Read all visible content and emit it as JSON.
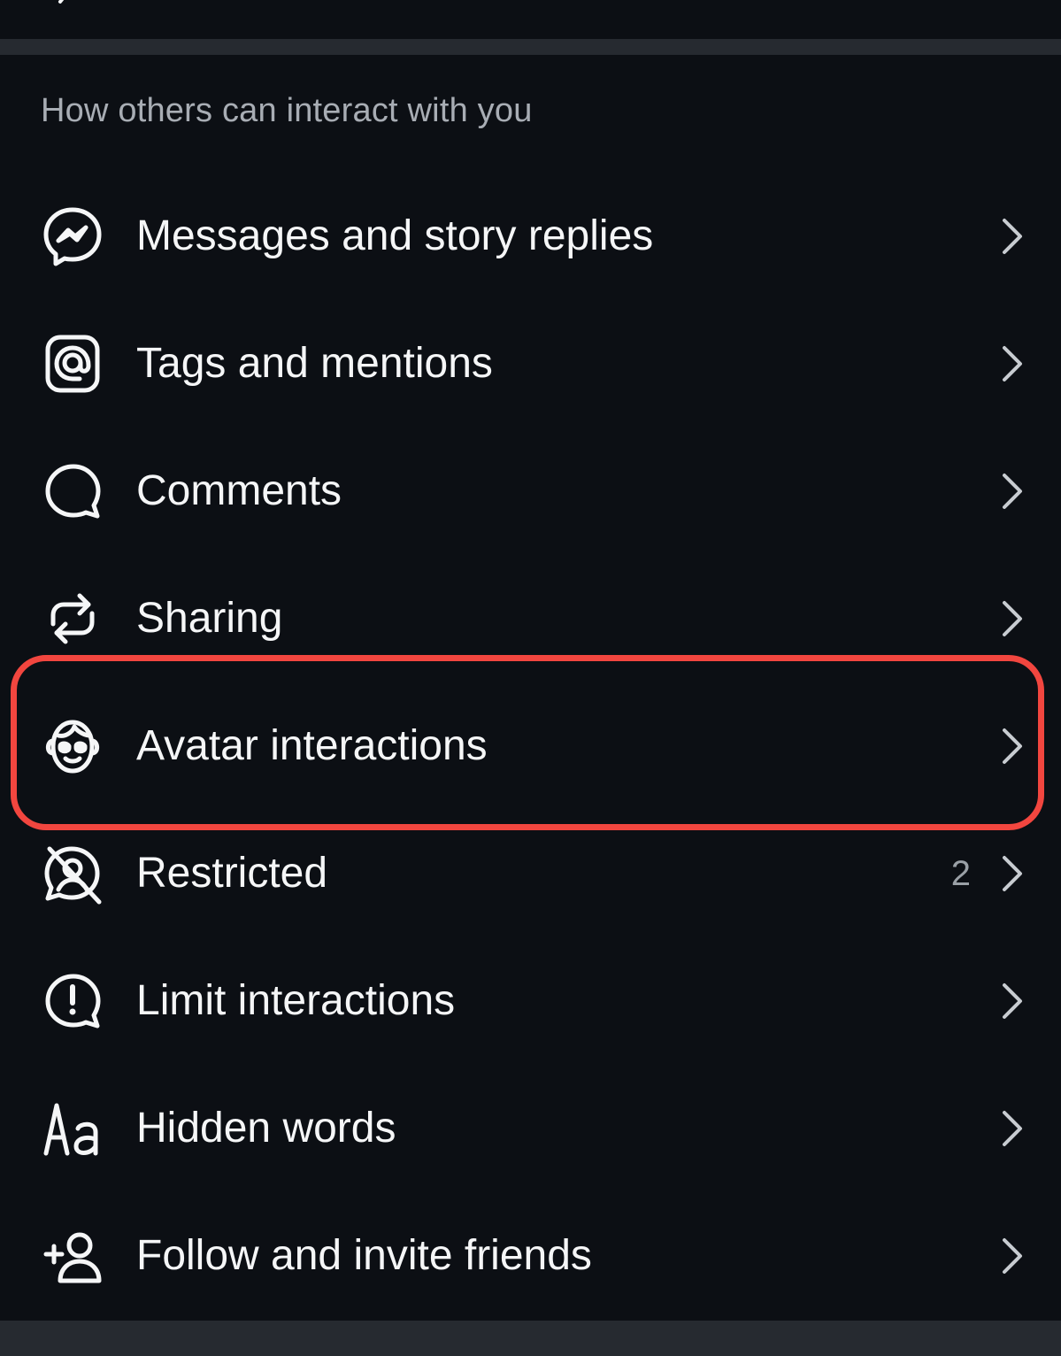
{
  "section": {
    "title": "How others can interact with you"
  },
  "items": [
    {
      "label": "Messages and story replies",
      "icon": "messenger-icon",
      "count": ""
    },
    {
      "label": "Tags and mentions",
      "icon": "at-sign-icon",
      "count": ""
    },
    {
      "label": "Comments",
      "icon": "comment-bubble-icon",
      "count": ""
    },
    {
      "label": "Sharing",
      "icon": "repost-icon",
      "count": ""
    },
    {
      "label": "Avatar interactions",
      "icon": "avatar-face-icon",
      "count": ""
    },
    {
      "label": "Restricted",
      "icon": "restricted-icon",
      "count": "2"
    },
    {
      "label": "Limit interactions",
      "icon": "alert-bubble-icon",
      "count": ""
    },
    {
      "label": "Hidden words",
      "icon": "text-aa-icon",
      "count": ""
    },
    {
      "label": "Follow and invite friends",
      "icon": "add-person-icon",
      "count": ""
    }
  ],
  "highlight": {
    "item": "Avatar interactions",
    "color": "#f2463f"
  },
  "colors": {
    "background": "#0c0f14",
    "divider": "#262a30",
    "text": "#f5f6f7",
    "muted": "#a8adb4",
    "chevron": "#c8ccd1"
  }
}
